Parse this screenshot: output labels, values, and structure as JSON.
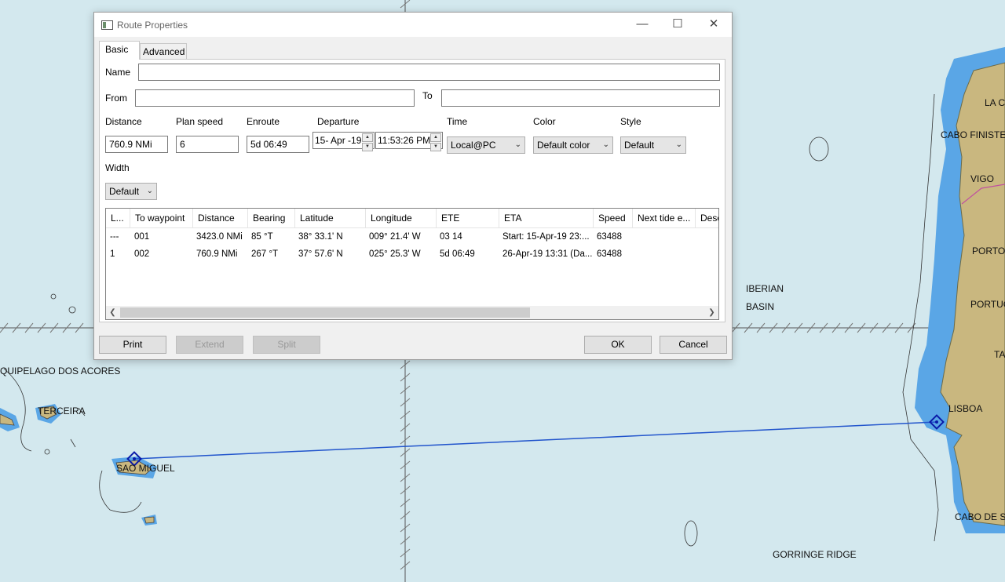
{
  "dialog": {
    "title": "Route Properties",
    "tabs": [
      {
        "label": "Basic"
      },
      {
        "label": "Advanced"
      }
    ],
    "fields": {
      "name": {
        "label": "Name",
        "value": ""
      },
      "from": {
        "label": "From",
        "value": ""
      },
      "to": {
        "label": "To",
        "value": ""
      },
      "distance": {
        "label": "Distance",
        "value": "760.9 NMi"
      },
      "plan_speed": {
        "label": "Plan speed",
        "value": "6"
      },
      "enroute": {
        "label": "Enroute",
        "value": "5d 06:49"
      },
      "departure": {
        "label": "Departure",
        "date": "15- Apr -19",
        "time": "11:53:26 PM"
      },
      "time": {
        "label": "Time",
        "value": "Local@PC"
      },
      "color": {
        "label": "Color",
        "value": "Default color"
      },
      "style": {
        "label": "Style",
        "value": "Default"
      },
      "width": {
        "label": "Width",
        "value": "Default"
      }
    },
    "table": {
      "columns": [
        "L...",
        "To waypoint",
        "Distance",
        "Bearing",
        "Latitude",
        "Longitude",
        "ETE",
        "ETA",
        "Speed",
        "Next tide e...",
        "Desc"
      ],
      "rows": [
        [
          "---",
          "001",
          "3423.0 NMi",
          "85 °T",
          "38° 33.1' N",
          "009° 21.4' W",
          "03 14",
          "Start: 15-Apr-19 23:...",
          "63488",
          "",
          ""
        ],
        [
          "1",
          "002",
          "760.9 NMi",
          "267 °T",
          "37° 57.6' N",
          "025° 25.3' W",
          "5d 06:49",
          "26-Apr-19 13:31 (Da...",
          "63488",
          "",
          ""
        ]
      ]
    },
    "buttons": {
      "print": "Print",
      "extend": "Extend",
      "split": "Split",
      "ok": "OK",
      "cancel": "Cancel"
    }
  },
  "map": {
    "labels": {
      "acores": "QUIPELAGO DOS ACORES",
      "terceira": "TERCEIRA",
      "sao_miguel": "SAO MIGUEL",
      "iberian_1": "IBERIAN",
      "iberian_2": "BASIN",
      "gorringe": "GORRINGE RIDGE",
      "lisboa": "LISBOA",
      "vigo": "VIGO",
      "cabo_finisterre": "CABO FINISTE",
      "la_c": "LA C",
      "porto": "PORTO",
      "portugal": "PORTUG",
      "ta": "TA",
      "cabo_de_s": "CABO DE S"
    },
    "colors": {
      "sea": "#d3e8ee",
      "shallow": "#5aa6e6",
      "land": "#c9b77f",
      "route": "#2255cc"
    }
  }
}
